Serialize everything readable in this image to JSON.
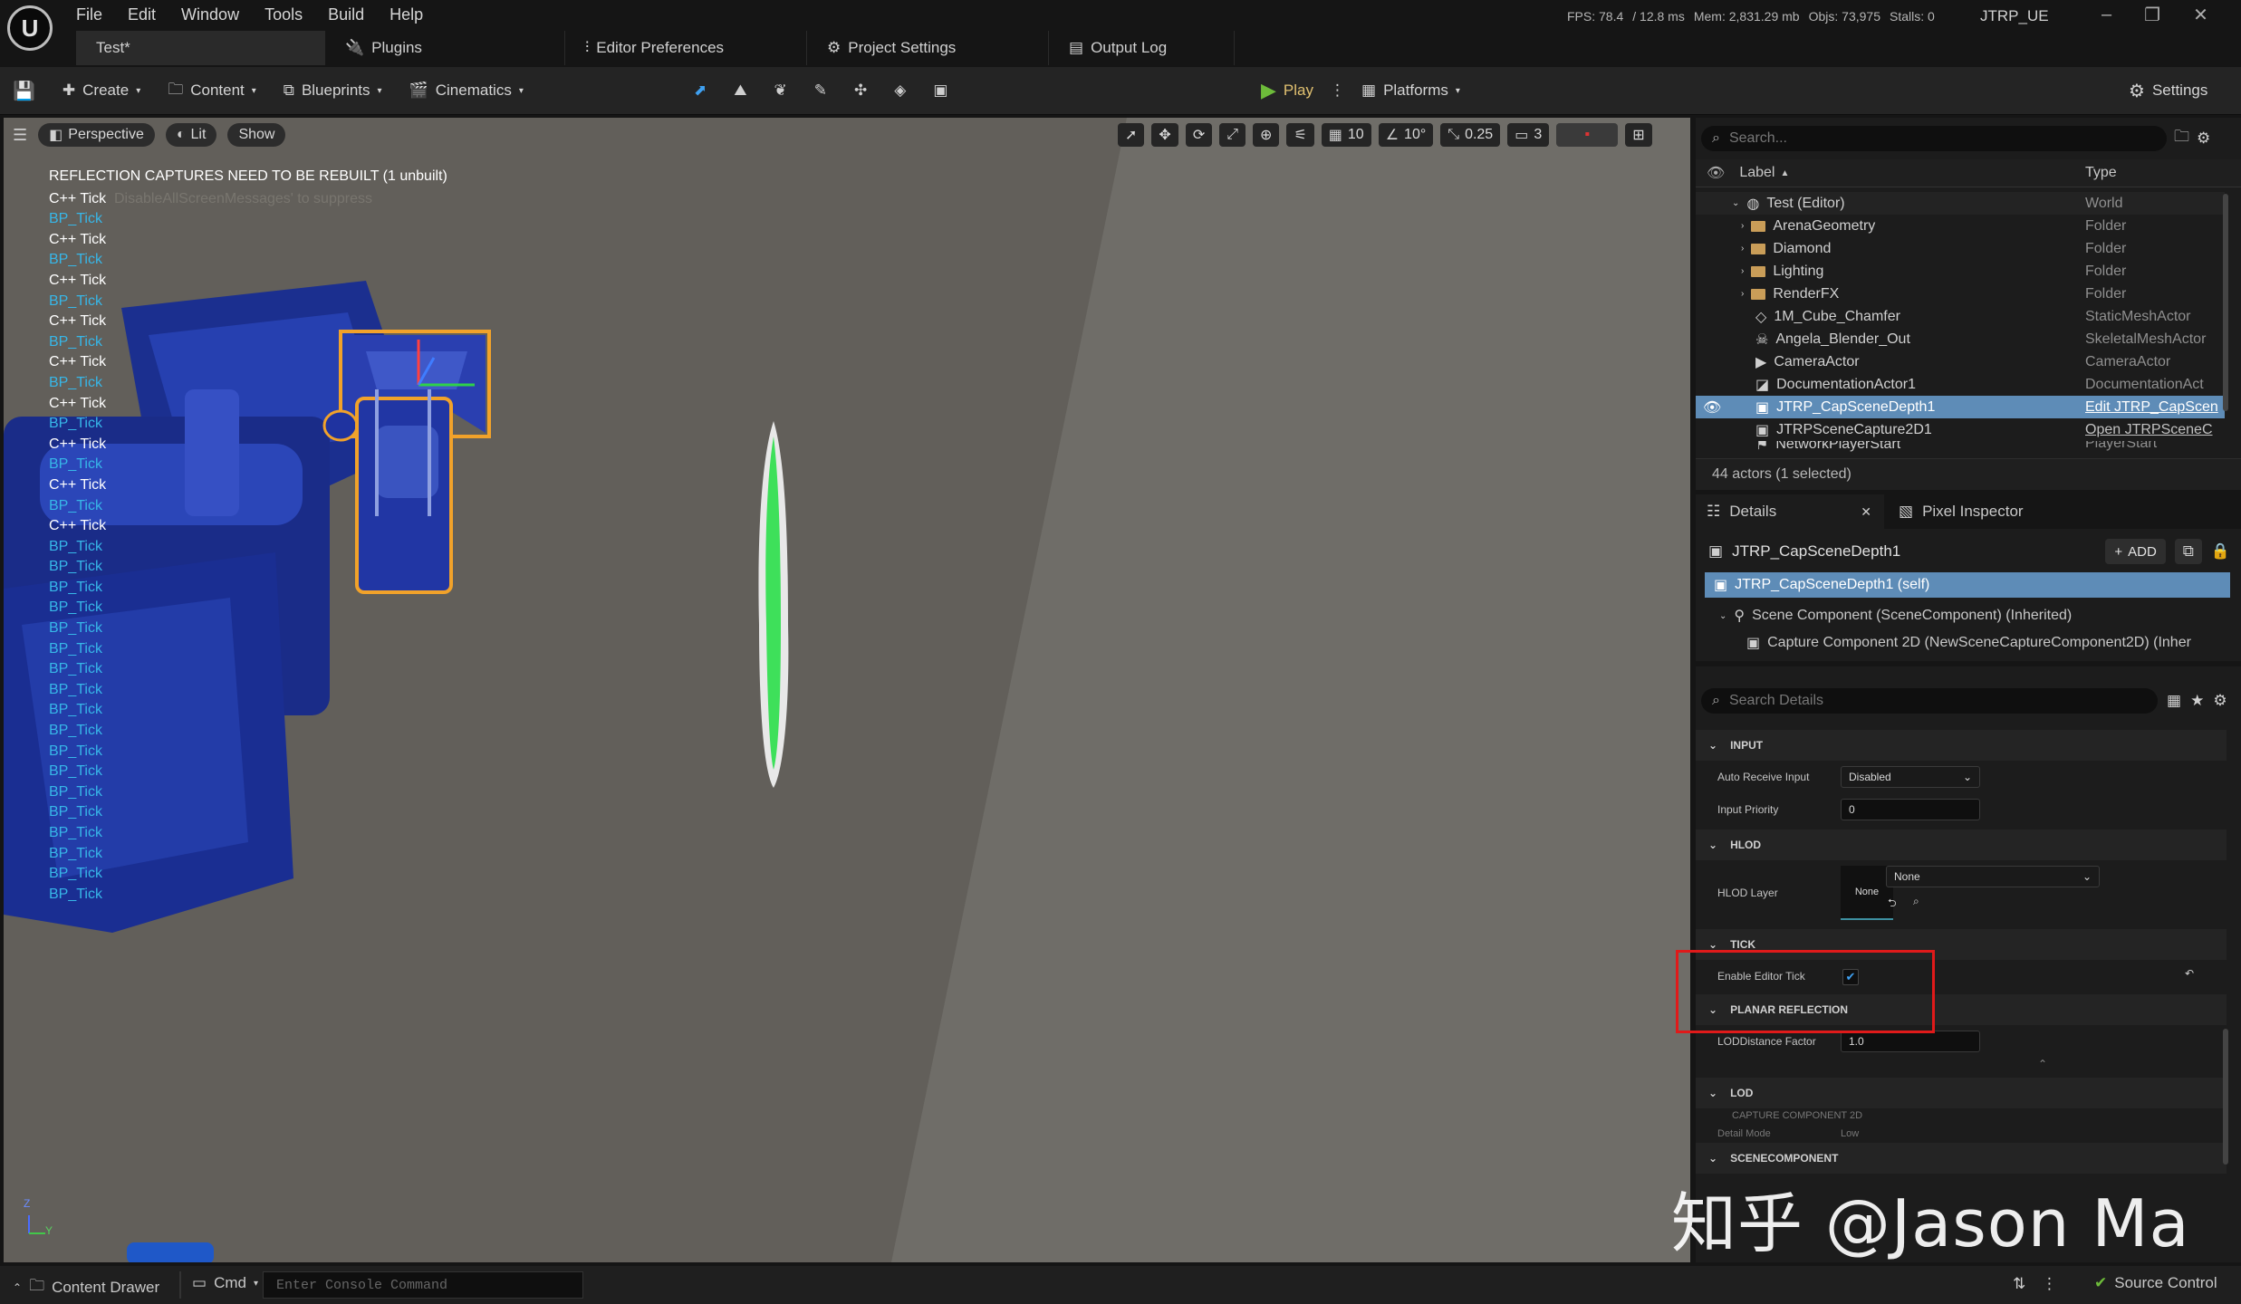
{
  "menu": [
    "File",
    "Edit",
    "Window",
    "Tools",
    "Build",
    "Help"
  ],
  "tabs": {
    "level": "Test*",
    "plugins": "Plugins",
    "editor_prefs": "Editor Preferences",
    "project_settings": "Project Settings",
    "output_log": "Output Log"
  },
  "stats": {
    "fps": "FPS: 78.4",
    "ms": "/ 12.8 ms",
    "mem": "Mem: 2,831.29 mb",
    "objs": "Objs: 73,975",
    "stalls": "Stalls: 0"
  },
  "project_name": "JTRP_UE",
  "toolbar": {
    "create": "Create",
    "content": "Content",
    "blueprints": "Blueprints",
    "cinematics": "Cinematics",
    "play": "Play",
    "platforms": "Platforms",
    "settings": "Settings"
  },
  "viewport": {
    "perspective": "Perspective",
    "lit": "Lit",
    "show": "Show",
    "grid": "10",
    "rotation": "10°",
    "scale": "0.25",
    "camera_speed": "3",
    "warning": "REFLECTION CAPTURES NEED TO BE REBUILT (1 unbuilt)",
    "ghost_text": "DisableAllScreenMessages' to suppress",
    "tick_lines": [
      "C++ Tick",
      "BP_Tick",
      "C++ Tick",
      "BP_Tick",
      "C++ Tick",
      "BP_Tick",
      "C++ Tick",
      "BP_Tick",
      "C++ Tick",
      "BP_Tick",
      "C++ Tick",
      "BP_Tick",
      "C++ Tick",
      "BP_Tick",
      "C++ Tick",
      "BP_Tick",
      "C++ Tick",
      "BP_Tick",
      "BP_Tick",
      "BP_Tick",
      "BP_Tick",
      "BP_Tick",
      "BP_Tick",
      "BP_Tick",
      "BP_Tick",
      "BP_Tick",
      "BP_Tick",
      "BP_Tick",
      "BP_Tick",
      "BP_Tick",
      "BP_Tick",
      "BP_Tick",
      "BP_Tick",
      "BP_Tick",
      "BP_Tick"
    ],
    "axis_z": "Z",
    "axis_y": "Y"
  },
  "outliner": {
    "search_placeholder": "Search...",
    "col_label": "Label",
    "col_type": "Type",
    "rows": [
      {
        "label": "Test (Editor)",
        "type": "World"
      },
      {
        "label": "ArenaGeometry",
        "type": "Folder"
      },
      {
        "label": "Diamond",
        "type": "Folder"
      },
      {
        "label": "Lighting",
        "type": "Folder"
      },
      {
        "label": "RenderFX",
        "type": "Folder"
      },
      {
        "label": "1M_Cube_Chamfer",
        "type": "StaticMeshActor"
      },
      {
        "label": "Angela_Blender_Out",
        "type": "SkeletalMeshActor"
      },
      {
        "label": "CameraActor",
        "type": "CameraActor"
      },
      {
        "label": "DocumentationActor1",
        "type": "DocumentationAct"
      },
      {
        "label": "JTRP_CapSceneDepth1",
        "type": "Edit JTRP_CapScen"
      },
      {
        "label": "JTRPSceneCapture2D1",
        "type": "Open JTRPSceneC"
      },
      {
        "label": "NetworkPlayerStart",
        "type": "PlayerStart"
      }
    ],
    "footer": "44 actors (1 selected)"
  },
  "details": {
    "tab_details": "Details",
    "tab_pixel": "Pixel Inspector",
    "actor_name": "JTRP_CapSceneDepth1",
    "add": "ADD",
    "self_row": "JTRP_CapSceneDepth1 (self)",
    "scene_component": "Scene Component (SceneComponent) (Inherited)",
    "capture_component": "Capture Component 2D (NewSceneCaptureComponent2D) (Inher",
    "search_placeholder": "Search Details",
    "sections": {
      "input": "INPUT",
      "hlod": "HLOD",
      "tick": "TICK",
      "planar": "PLANAR REFLECTION",
      "lod": "LOD",
      "scene": "SCENECOMPONENT"
    },
    "auto_receive_input_label": "Auto Receive Input",
    "auto_receive_input_value": "Disabled",
    "input_priority_label": "Input Priority",
    "input_priority_value": "0",
    "hlod_layer_label": "HLOD Layer",
    "hlod_thumb": "None",
    "hlod_value": "None",
    "enable_editor_tick_label": "Enable Editor Tick",
    "enable_editor_tick": true,
    "lod_distance_label": "LODDistance Factor",
    "lod_distance_value": "1.0",
    "lod_partial_1": "CAPTURE COMPONENT 2D",
    "lod_partial_2": "Detail Mode",
    "lod_partial_3": "Low"
  },
  "bottombar": {
    "content_drawer": "Content Drawer",
    "cmd": "Cmd",
    "console_placeholder": "Enter Console Command",
    "source_control": "Source Control"
  },
  "watermark": "知乎 @Jason Ma",
  "colors": {
    "selection": "#5e8cb7",
    "bp_tick": "#37b7e8",
    "highlight_box": "#e01a1a",
    "play_green": "#6dbb3a"
  }
}
